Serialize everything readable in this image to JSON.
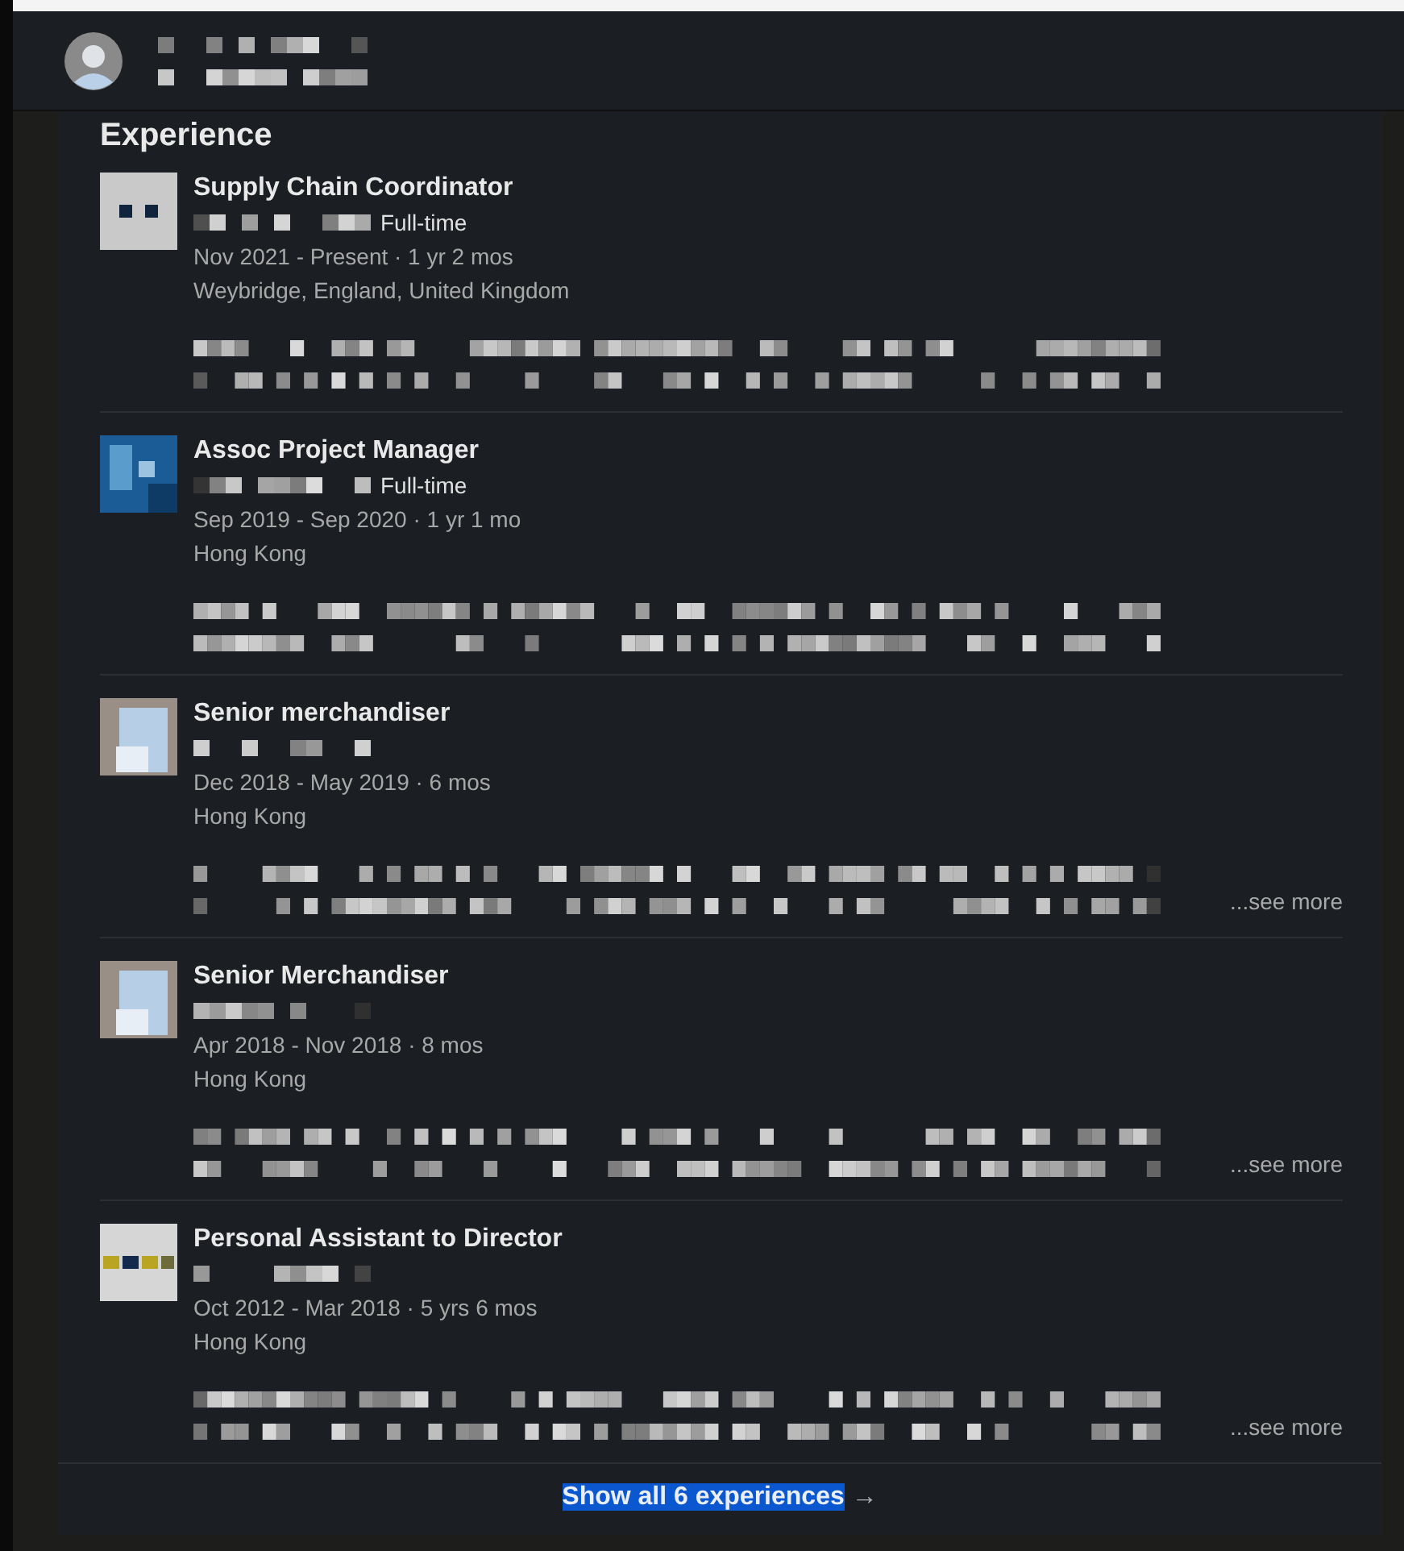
{
  "section": {
    "title": "Experience"
  },
  "experiences": [
    {
      "logo": {
        "kind": "dots"
      },
      "title": "Supply Chain Coordinator",
      "employment_type": "Full-time",
      "dates": "Nov 2021 - Present · 1 yr 2 mos",
      "location": "Weybridge, England, United Kingdom"
    },
    {
      "logo": {
        "kind": "blue"
      },
      "title": "Assoc Project Manager",
      "employment_type": "Full-time",
      "dates": "Sep 2019 - Sep 2020 · 1 yr 1 mo",
      "location": "Hong Kong"
    },
    {
      "logo": {
        "kind": "building"
      },
      "title": "Senior merchandiser",
      "dates": "Dec 2018 - May 2019 · 6 mos",
      "location": "Hong Kong",
      "see_more": "...see more"
    },
    {
      "logo": {
        "kind": "building"
      },
      "title": "Senior Merchandiser",
      "dates": "Apr 2018 - Nov 2018 · 8 mos",
      "location": "Hong Kong",
      "see_more": "...see more"
    },
    {
      "logo": {
        "kind": "stripes"
      },
      "title": "Personal Assistant to Director",
      "dates": "Oct 2012 - Mar 2018 · 5 yrs 6 mos",
      "location": "Hong Kong",
      "see_more": "...see more"
    }
  ],
  "show_all": {
    "label": "Show all 6 experiences",
    "arrow": "→"
  }
}
